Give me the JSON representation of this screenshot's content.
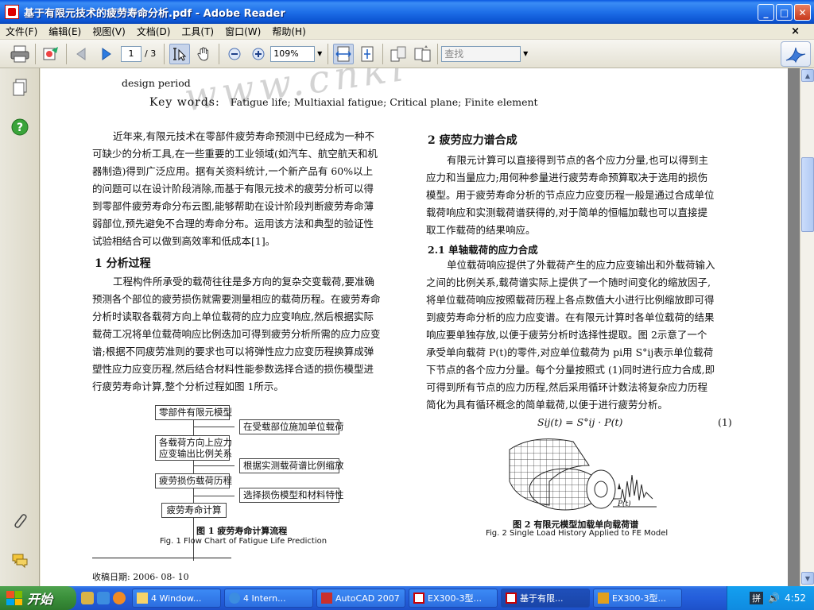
{
  "window": {
    "title": "基于有限元技术的疲劳寿命分析.pdf - Adobe Reader",
    "min_label": "_",
    "max_label": "□",
    "close_label": "✕"
  },
  "menu": {
    "items": [
      "文件(F)",
      "编辑(E)",
      "视图(V)",
      "文档(D)",
      "工具(T)",
      "窗口(W)",
      "帮助(H)"
    ],
    "doc_close": "×"
  },
  "toolbar": {
    "page_current": "1",
    "page_total": "/ 3",
    "zoom": "109%",
    "search_placeholder": "查找"
  },
  "doc": {
    "abstract_tail": "design period",
    "keywords_label": "Key words:",
    "keywords": "Fatigue life;  Multiaxial fatigue;  Critical plane;  Finite element",
    "watermark": "www.cnki",
    "left_para1": [
      "近年来,有限元技术在零部件疲劳寿命预测中已经成为一种不",
      "可缺少的分析工具,在一些重要的工业领域(如汽车、航空航天和机",
      "器制造)得到广泛应用。据有关资料统计,一个新产品有 60%以上",
      "的问题可以在设计阶段消除,而基于有限元技术的疲劳分析可以得",
      "到零部件疲劳寿命分布云图,能够帮助在设计阶段判断疲劳寿命薄",
      "弱部位,预先避免不合理的寿命分布。运用该方法和典型的验证性",
      "试验相结合可以做到高效率和低成本[1]。"
    ],
    "sec1_title": "1   分析过程",
    "left_para2": [
      "工程构件所承受的载荷往往是多方向的复杂交变载荷,要准确",
      "预测各个部位的疲劳损伤就需要测量相应的载荷历程。在疲劳寿命",
      "分析时读取各载荷方向上单位载荷的应力应变响应,然后根据实际",
      "载荷工况将单位载荷响应比例迭加可得到疲劳分析所需的应力应变",
      "谱;根据不同疲劳准则的要求也可以将弹性应力应变历程换算成弹",
      "塑性应力应变历程,然后结合材料性能参数选择合适的损伤模型进",
      "行疲劳寿命计算,整个分析过程如图 1所示。"
    ],
    "flow": {
      "box1": "零部件有限元模型",
      "side1": "在受载部位施加单位载荷",
      "box2a": "各载荷方向上应力",
      "box2b": "应变输出比例关系",
      "side2": "根据实测载荷谱比例缩放",
      "box3": "疲劳损伤载荷历程",
      "side3": "选择损伤模型和材料特性",
      "box4": "疲劳寿命计算"
    },
    "fig1_cn": "图 1   疲劳寿命计算流程",
    "fig1_en": "Fig. 1  Flow Chart of Fatigue Life Prediction",
    "received": "收稿日期: 2006- 08- 10",
    "sec2_title": "2   疲劳应力谱合成",
    "right_para1": [
      "有限元计算可以直接得到节点的各个应力分量,也可以得到主",
      "应力和当量应力;用何种参量进行疲劳寿命预算取决于选用的损伤",
      "模型。用于疲劳寿命分析的节点应力应变历程一般是通过合成单位",
      "载荷响应和实测载荷谱获得的,对于简单的恒幅加载也可以直接提",
      "取工作载荷的结果响应。"
    ],
    "sec21_title": "2.1   单轴载荷的应力合成",
    "right_para2": [
      "单位载荷响应提供了外载荷产生的应力应变输出和外载荷输入",
      "之间的比例关系,载荷谱实际上提供了一个随时间变化的缩放因子,",
      "将单位载荷响应按照载荷历程上各点数值大小进行比例缩放即可得",
      "到疲劳寿命分析的应力应变谱。在有限元计算时各单位载荷的结果",
      "响应要单独存放,以便于疲劳分析时选择性提取。图 2示意了一个",
      "承受单向载荷 P(t)的零件,对应单位载荷为 pi用 S°ij表示单位载荷",
      "下节点的各个应力分量。每个分量按照式 (1)同时进行应力合成,即",
      "可得到所有节点的应力历程,然后采用循环计数法将复杂应力历程",
      "简化为具有循环概念的简单载荷,以便于进行疲劳分析。"
    ],
    "equation": "Sij(t) = S°ij · P(t)",
    "eq_number": "(1)",
    "pt_label": "P(t)",
    "fig2_cn": "图 2   有限元模型加载单向载荷谱",
    "fig2_en": "Fig. 2  Single Load History Applied to FE Model"
  },
  "taskbar": {
    "start": "开始",
    "tasks": [
      "4 Window...",
      "4 Intern...",
      "AutoCAD 2007",
      "EX300-3型...",
      "基于有限...",
      "EX300-3型..."
    ],
    "clock": "4:52",
    "tray_lang": "拼"
  }
}
